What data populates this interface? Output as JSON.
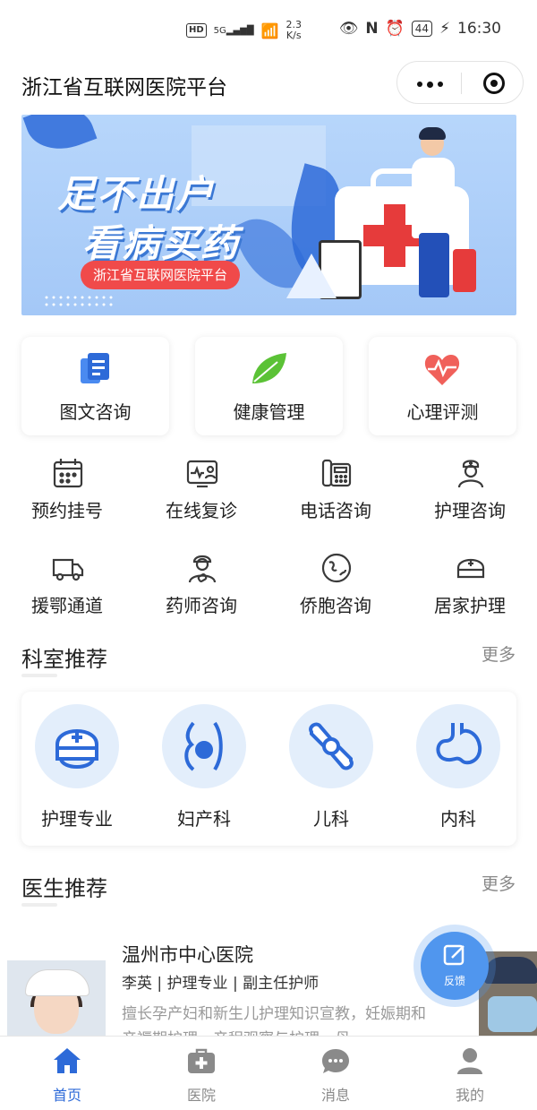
{
  "status_bar": {
    "hd": "HD",
    "signal": "5G",
    "net_speed_value": "2.3",
    "net_speed_unit": "K/s",
    "nfc": "N",
    "battery": "44",
    "time": "16:30"
  },
  "header": {
    "title": "浙江省互联网医院平台"
  },
  "banner": {
    "headline_line1": "足不出户",
    "headline_line2": "看病买药",
    "pill_text": "浙江省互联网医院平台"
  },
  "feature_cards": [
    {
      "label": "图文咨询",
      "icon": "document-chat-icon"
    },
    {
      "label": "健康管理",
      "icon": "leaf-icon"
    },
    {
      "label": "心理评测",
      "icon": "heart-pulse-icon"
    }
  ],
  "services": [
    {
      "label": "预约挂号",
      "icon": "calendar-icon"
    },
    {
      "label": "在线复诊",
      "icon": "video-consult-icon"
    },
    {
      "label": "电话咨询",
      "icon": "telephone-icon"
    },
    {
      "label": "护理咨询",
      "icon": "nurse-icon"
    },
    {
      "label": "援鄂通道",
      "icon": "truck-icon"
    },
    {
      "label": "药师咨询",
      "icon": "pharmacist-icon"
    },
    {
      "label": "侨胞咨询",
      "icon": "globe-icon"
    },
    {
      "label": "居家护理",
      "icon": "nurse-cap-icon"
    }
  ],
  "departments_section": {
    "title": "科室推荐",
    "more": "更多",
    "items": [
      {
        "label": "护理专业",
        "icon": "nurse-cap-icon"
      },
      {
        "label": "妇产科",
        "icon": "pregnancy-icon"
      },
      {
        "label": "儿科",
        "icon": "bone-joint-icon"
      },
      {
        "label": "内科",
        "icon": "stomach-icon"
      }
    ]
  },
  "doctors_section": {
    "title": "医生推荐",
    "more": "更多",
    "doctor": {
      "hospital": "温州市中心医院",
      "meta": "李英 | 护理专业 | 副主任护师",
      "description": "擅长孕产妇和新生儿护理知识宣教，妊娠期和产褥期护理，产程观察与护理，母"
    }
  },
  "feedback": {
    "label": "反馈"
  },
  "tab_bar": [
    {
      "label": "首页",
      "icon": "home-icon",
      "active": true
    },
    {
      "label": "医院",
      "icon": "medical-kit-icon",
      "active": false
    },
    {
      "label": "消息",
      "icon": "chat-bubble-icon",
      "active": false
    },
    {
      "label": "我的",
      "icon": "person-icon",
      "active": false
    }
  ],
  "colors": {
    "accent": "#2d6ad8",
    "banner_pill": "#f04a4a",
    "icon_blue": "#2d6ad8",
    "icon_dark": "#3a3a3a"
  }
}
